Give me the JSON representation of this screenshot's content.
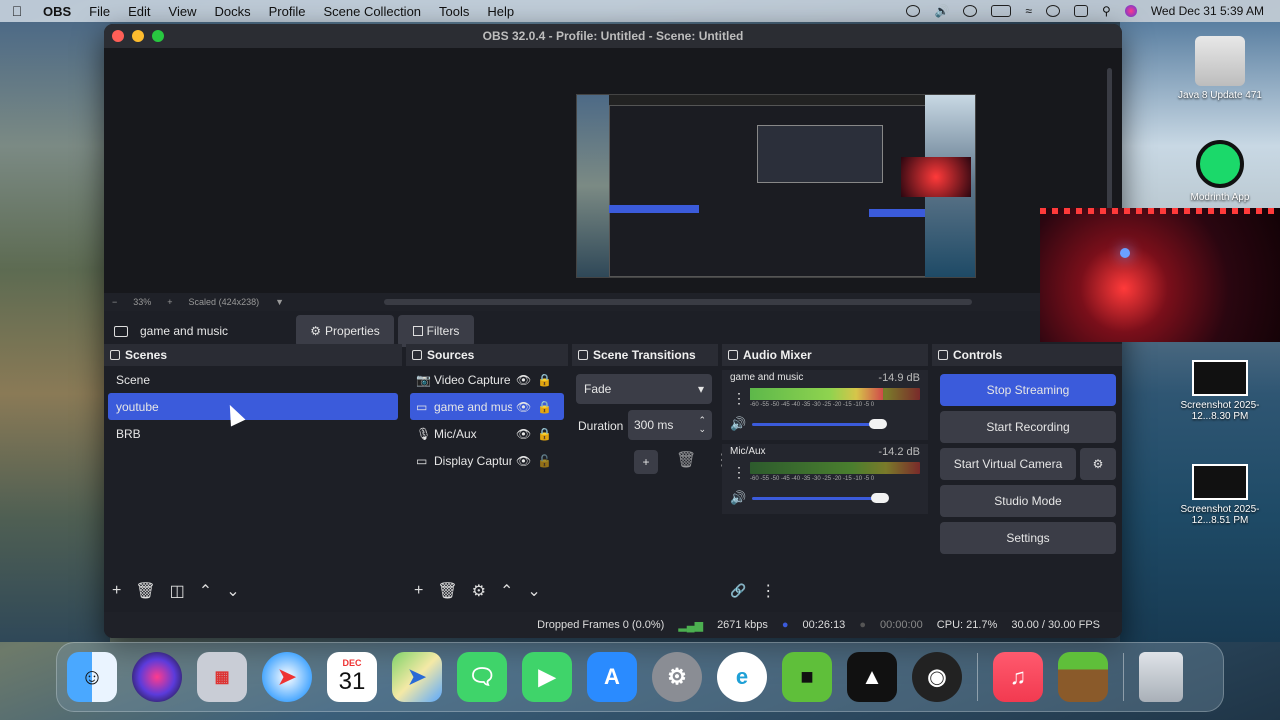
{
  "menubar": {
    "app_name": "OBS",
    "items": [
      "File",
      "Edit",
      "View",
      "Docks",
      "Profile",
      "Scene Collection",
      "Tools",
      "Help"
    ],
    "clock": "Wed Dec 31  5:39 AM"
  },
  "desktop": {
    "icons": [
      {
        "label": "Java 8 Update 471"
      },
      {
        "label": "Modrinth App"
      },
      {
        "label": "Screenshot 2025-12...8.30 PM"
      },
      {
        "label": "Screenshot 2025-12...8.51 PM"
      }
    ]
  },
  "window": {
    "title": "OBS 32.0.4 - Profile: Untitled - Scene: Untitled"
  },
  "preview": {
    "zoom_minus": "−",
    "zoom_level": "33%",
    "zoom_plus": "+",
    "scale_label": "Scaled (424x238)"
  },
  "source_bar": {
    "current_source": "game and music",
    "properties_label": "Properties",
    "filters_label": "Filters"
  },
  "scenes": {
    "title": "Scenes",
    "items": [
      {
        "label": "Scene",
        "selected": false
      },
      {
        "label": "youtube",
        "selected": true
      },
      {
        "label": "BRB",
        "selected": false
      }
    ]
  },
  "sources": {
    "title": "Sources",
    "items": [
      {
        "label": "Video Capture",
        "selected": false
      },
      {
        "label": "game and music",
        "selected": true
      },
      {
        "label": "Mic/Aux",
        "selected": false
      },
      {
        "label": "Display Capture",
        "selected": false
      }
    ]
  },
  "transitions": {
    "title": "Scene Transitions",
    "type": "Fade",
    "duration_label": "Duration",
    "duration_value": "300 ms"
  },
  "mixer": {
    "title": "Audio Mixer",
    "tick_labels": "-60 -55 -50 -45 -40 -35 -30 -25 -20 -15 -10 -5 0",
    "channels": [
      {
        "name": "game and music",
        "db": "-14.9 dB",
        "level": 0.78,
        "volume": 0.74
      },
      {
        "name": "Mic/Aux",
        "db": "-14.2 dB",
        "level": 0.0,
        "volume": 0.75
      }
    ]
  },
  "controls": {
    "title": "Controls",
    "stop_streaming": "Stop Streaming",
    "start_recording": "Start Recording",
    "start_virtual_camera": "Start Virtual Camera",
    "studio_mode": "Studio Mode",
    "settings": "Settings"
  },
  "status": {
    "dropped_frames": "Dropped Frames 0 (0.0%)",
    "bitrate": "2671 kbps",
    "stream_time": "00:26:13",
    "record_time": "00:00:00",
    "cpu": "CPU: 21.7%",
    "fps": "30.00 / 30.00 FPS"
  },
  "dock": {
    "calendar_month": "DEC",
    "calendar_day": "31",
    "apps": [
      "finder-icon",
      "siri-icon",
      "launchpad-icon",
      "safari-icon",
      "calendar-icon",
      "maps-icon",
      "messages-icon",
      "facetime-icon",
      "app-store-icon",
      "system-settings-icon",
      "edge-icon",
      "minecraft-icon",
      "anvil-icon",
      "obs-icon",
      "music-icon",
      "minecraft-block-icon",
      "trash-icon"
    ]
  }
}
